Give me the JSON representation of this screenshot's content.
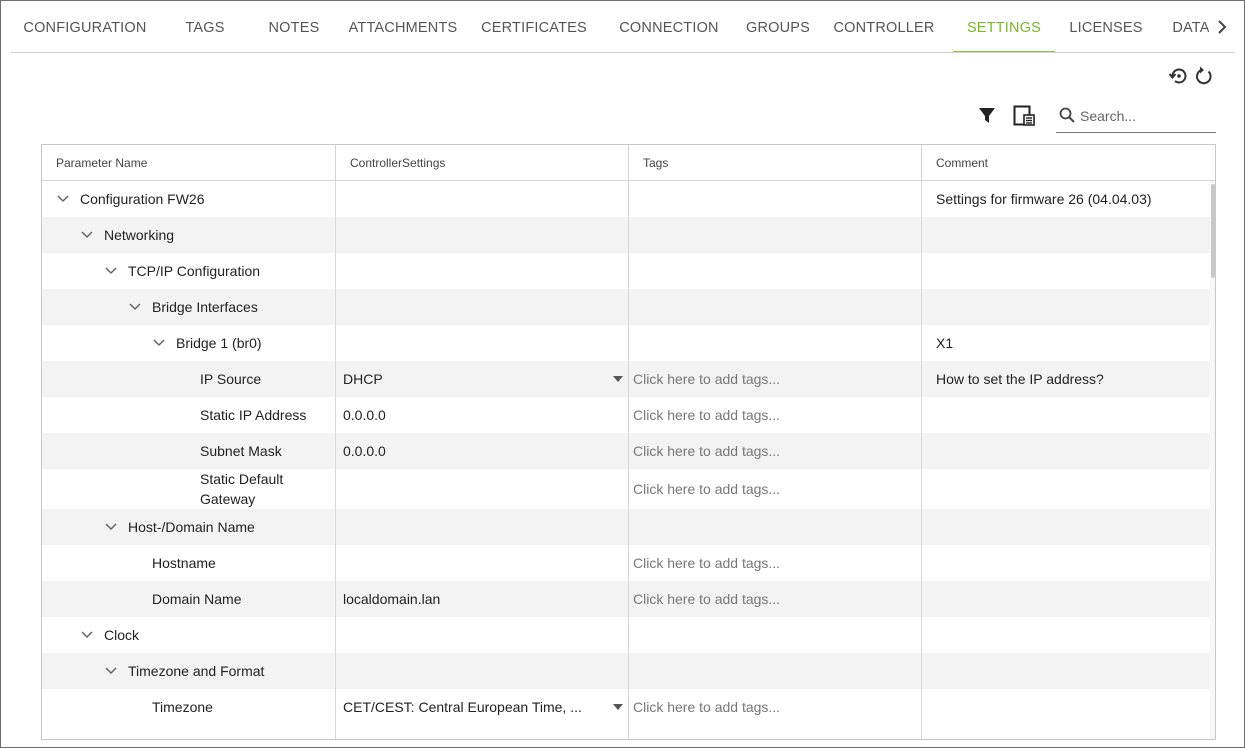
{
  "tabs": [
    {
      "label": "CONFIGURATION",
      "active": false
    },
    {
      "label": "TAGS",
      "active": false
    },
    {
      "label": "NOTES",
      "active": false
    },
    {
      "label": "ATTACHMENTS",
      "active": false
    },
    {
      "label": "CERTIFICATES",
      "active": false
    },
    {
      "label": "CONNECTION",
      "active": false
    },
    {
      "label": "GROUPS",
      "active": false
    },
    {
      "label": "CONTROLLER",
      "active": false
    },
    {
      "label": "SETTINGS",
      "active": true
    },
    {
      "label": "LICENSES",
      "active": false
    },
    {
      "label": "DATA",
      "active": false
    }
  ],
  "accent_color": "#8cc63f",
  "toolbar": {
    "history_icon": "history-icon",
    "reset_icon": "reset-icon",
    "filter_icon": "filter-icon",
    "columns_icon": "column-chooser-icon"
  },
  "search": {
    "placeholder": "Search...",
    "value": ""
  },
  "grid": {
    "columns": [
      "Parameter Name",
      "ControllerSettings",
      "Tags",
      "Comment"
    ],
    "tags_placeholder": "Click here to add tags...",
    "rows": [
      {
        "name": "Configuration FW26",
        "level": 0,
        "expandable": true,
        "value": "",
        "dropdown": false,
        "tags": "",
        "comment": "Settings for firmware 26 (04.04.03)"
      },
      {
        "name": "Networking",
        "level": 1,
        "expandable": true,
        "value": "",
        "dropdown": false,
        "tags": "",
        "comment": ""
      },
      {
        "name": "TCP/IP Configuration",
        "level": 2,
        "expandable": true,
        "value": "",
        "dropdown": false,
        "tags": "",
        "comment": ""
      },
      {
        "name": "Bridge Interfaces",
        "level": 3,
        "expandable": true,
        "value": "",
        "dropdown": false,
        "tags": "",
        "comment": ""
      },
      {
        "name": "Bridge 1 (br0)",
        "level": 4,
        "expandable": true,
        "value": "",
        "dropdown": false,
        "tags": "",
        "comment": "X1"
      },
      {
        "name": "IP Source",
        "level": 5,
        "expandable": false,
        "value": "DHCP",
        "dropdown": true,
        "tags": "Click here to add tags...",
        "comment": "How to set the IP address?"
      },
      {
        "name": "Static IP Address",
        "level": 5,
        "expandable": false,
        "value": "0.0.0.0",
        "dropdown": false,
        "tags": "Click here to add tags...",
        "comment": ""
      },
      {
        "name": "Subnet Mask",
        "level": 5,
        "expandable": false,
        "value": "0.0.0.0",
        "dropdown": false,
        "tags": "Click here to add tags...",
        "comment": ""
      },
      {
        "name": "Static Default Gateway",
        "level": 5,
        "expandable": false,
        "value": "",
        "dropdown": false,
        "tags": "Click here to add tags...",
        "comment": ""
      },
      {
        "name": "Host-/Domain Name",
        "level": 2,
        "expandable": true,
        "value": "",
        "dropdown": false,
        "tags": "",
        "comment": ""
      },
      {
        "name": "Hostname",
        "level": 3,
        "expandable": false,
        "value": "",
        "dropdown": false,
        "tags": "Click here to add tags...",
        "comment": ""
      },
      {
        "name": "Domain Name",
        "level": 3,
        "expandable": false,
        "value": "localdomain.lan",
        "dropdown": false,
        "tags": "Click here to add tags...",
        "comment": ""
      },
      {
        "name": "Clock",
        "level": 1,
        "expandable": true,
        "value": "",
        "dropdown": false,
        "tags": "",
        "comment": ""
      },
      {
        "name": "Timezone and Format",
        "level": 2,
        "expandable": true,
        "value": "",
        "dropdown": false,
        "tags": "",
        "comment": ""
      },
      {
        "name": "Timezone",
        "level": 3,
        "expandable": false,
        "value": "CET/CEST: Central European Time, ...",
        "dropdown": true,
        "tags": "Click here to add tags...",
        "comment": ""
      }
    ]
  }
}
